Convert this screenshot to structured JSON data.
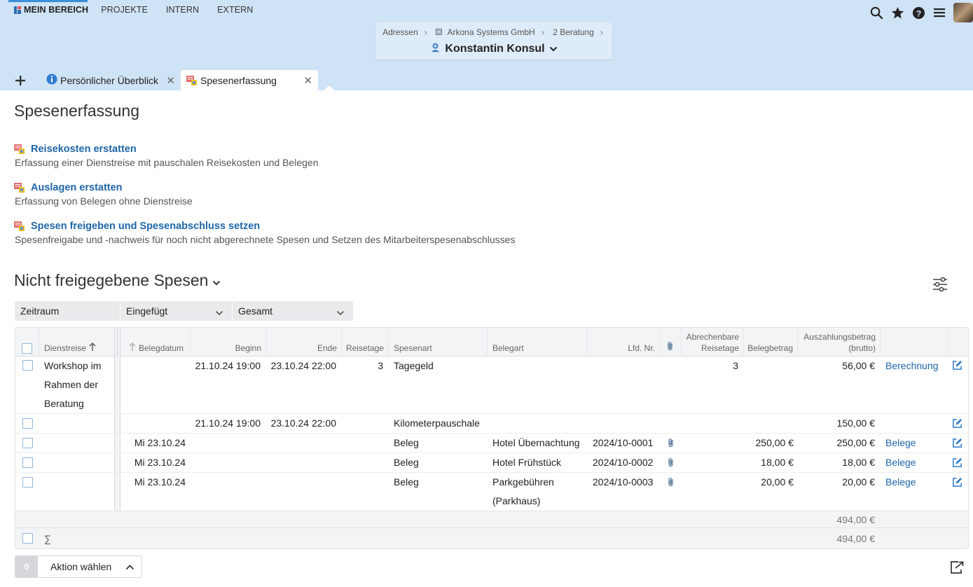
{
  "nav": {
    "items": [
      "MEIN BEREICH",
      "PROJEKTE",
      "INTERN",
      "EXTERN"
    ]
  },
  "context": {
    "breadcrumb": [
      "Adressen",
      "Arkona Systems GmbH",
      "2 Beratung"
    ],
    "person": "Konstantin Konsul"
  },
  "tabs": [
    {
      "label": "Persönlicher Überblick"
    },
    {
      "label": "Spesenerfassung"
    }
  ],
  "page": {
    "title": "Spesenerfassung",
    "actions": [
      {
        "label": "Reisekosten erstatten",
        "desc": "Erfassung einer Dienstreise mit pauschalen Reisekosten und Belegen"
      },
      {
        "label": "Auslagen erstatten",
        "desc": "Erfassung von Belegen ohne Dienstreise"
      },
      {
        "label": "Spesen freigeben und Spesenabschluss setzen",
        "desc": "Spesenfreigabe und -nachweis für noch nicht abgerechnete Spesen und Setzen des Mitarbeiterspesenabschlusses"
      }
    ]
  },
  "section": {
    "title": "Nicht freigegebene Spesen"
  },
  "filters": {
    "zeitraum": "Zeitraum",
    "basis": "Eingefügt",
    "range": "Gesamt"
  },
  "table": {
    "headers": {
      "dienstreise": "Dienstreise",
      "belegdatum": "Belegdatum",
      "beginn": "Beginn",
      "ende": "Ende",
      "reisetage": "Reisetage",
      "spesenart": "Spesenart",
      "belegart": "Belegart",
      "lfd": "Lfd. Nr.",
      "abr_reisetage_1": "Abrechenbare",
      "abr_reisetage_2": "Reisetage",
      "belegbetrag": "Belegbetrag",
      "auszahlung_1": "Auszahlungsbetrag",
      "auszahlung_2": "(brutto)"
    },
    "dienstreise_text": "Workshop im Rahmen der Beratung",
    "rows": [
      {
        "belegdatum": "",
        "beginn": "21.10.24 19:00",
        "ende": "23.10.24 22:00",
        "reisetage": "3",
        "spesenart": "Tagegeld",
        "belegart": "",
        "lfd": "",
        "abr": "3",
        "belegbetrag": "",
        "auszahlung": "56,00 €",
        "link": "Berechnung"
      },
      {
        "belegdatum": "",
        "beginn": "21.10.24 19:00",
        "ende": "23.10.24 22:00",
        "reisetage": "",
        "spesenart": "Kilometerpauschale",
        "belegart": "",
        "lfd": "",
        "abr": "",
        "belegbetrag": "",
        "auszahlung": "150,00 €",
        "link": ""
      },
      {
        "belegdatum": "Mi 23.10.24",
        "beginn": "",
        "ende": "",
        "reisetage": "",
        "spesenart": "Beleg",
        "belegart": "Hotel Übernachtung",
        "lfd": "2024/10-0001",
        "abr": "",
        "belegbetrag": "250,00 €",
        "auszahlung": "250,00 €",
        "link": "Belege"
      },
      {
        "belegdatum": "Mi 23.10.24",
        "beginn": "",
        "ende": "",
        "reisetage": "",
        "spesenart": "Beleg",
        "belegart": "Hotel Frühstück",
        "lfd": "2024/10-0002",
        "abr": "",
        "belegbetrag": "18,00 €",
        "auszahlung": "18,00 €",
        "link": "Belege"
      },
      {
        "belegdatum": "Mi 23.10.24",
        "beginn": "",
        "ende": "",
        "reisetage": "",
        "spesenart": "Beleg",
        "belegart": "Parkgebühren (Parkhaus)",
        "lfd": "2024/10-0003",
        "abr": "",
        "belegbetrag": "20,00 €",
        "auszahlung": "20,00 €",
        "link": "Belege"
      }
    ],
    "subtotal": "494,00 €",
    "sum_symbol": "∑",
    "total": "494,00 €"
  },
  "footer": {
    "count": "0",
    "action_label": "Aktion wählen"
  },
  "colors": {
    "header_bg": "#cfe3f6",
    "link": "#1e66a8",
    "checkbox_border": "#8fb6dc"
  }
}
